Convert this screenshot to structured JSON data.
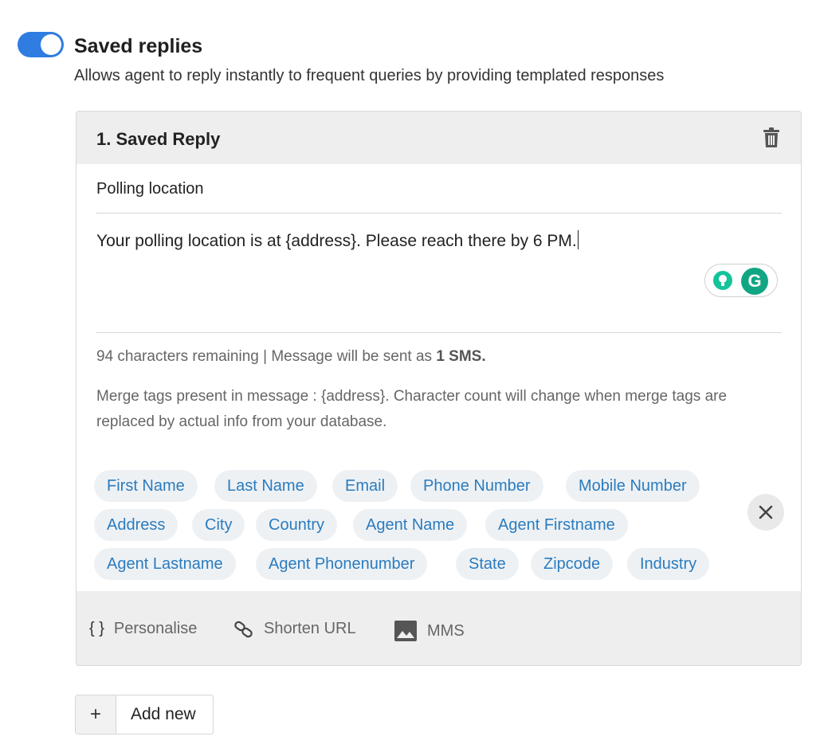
{
  "feature": {
    "title": "Saved replies",
    "description": "Allows agent to reply instantly to frequent queries by providing templated responses",
    "enabled": true
  },
  "reply": {
    "title": "1. Saved Reply",
    "name": "Polling location",
    "message": "Your polling location is at {address}. Please reach there by 6 PM."
  },
  "counter": {
    "prefix": "94 characters remaining | Message will be sent as ",
    "sms": "1 SMS."
  },
  "merge_note": "Merge tags present in message : {address}. Character count will change when merge tags are replaced by actual info from your database.",
  "merge_tags": [
    "First Name",
    "Last Name",
    "Email",
    "Phone Number",
    "Mobile Number",
    "Address",
    "City",
    "Country",
    "Agent Name",
    "Agent Firstname",
    "Agent Lastname",
    "Agent Phonenumber",
    "State",
    "Zipcode",
    "Industry"
  ],
  "toolbar": {
    "personalise_icon": "{ }",
    "personalise": "Personalise",
    "shorten": "Shorten URL",
    "mms": "MMS"
  },
  "grammarly_letter": "G",
  "add": {
    "symbol": "+",
    "label": "Add new"
  },
  "colors": {
    "toggle": "#2f7de1",
    "tag_text": "#2a7cbf",
    "tag_bg": "#eef1f4",
    "grammarly": "#11a683"
  }
}
